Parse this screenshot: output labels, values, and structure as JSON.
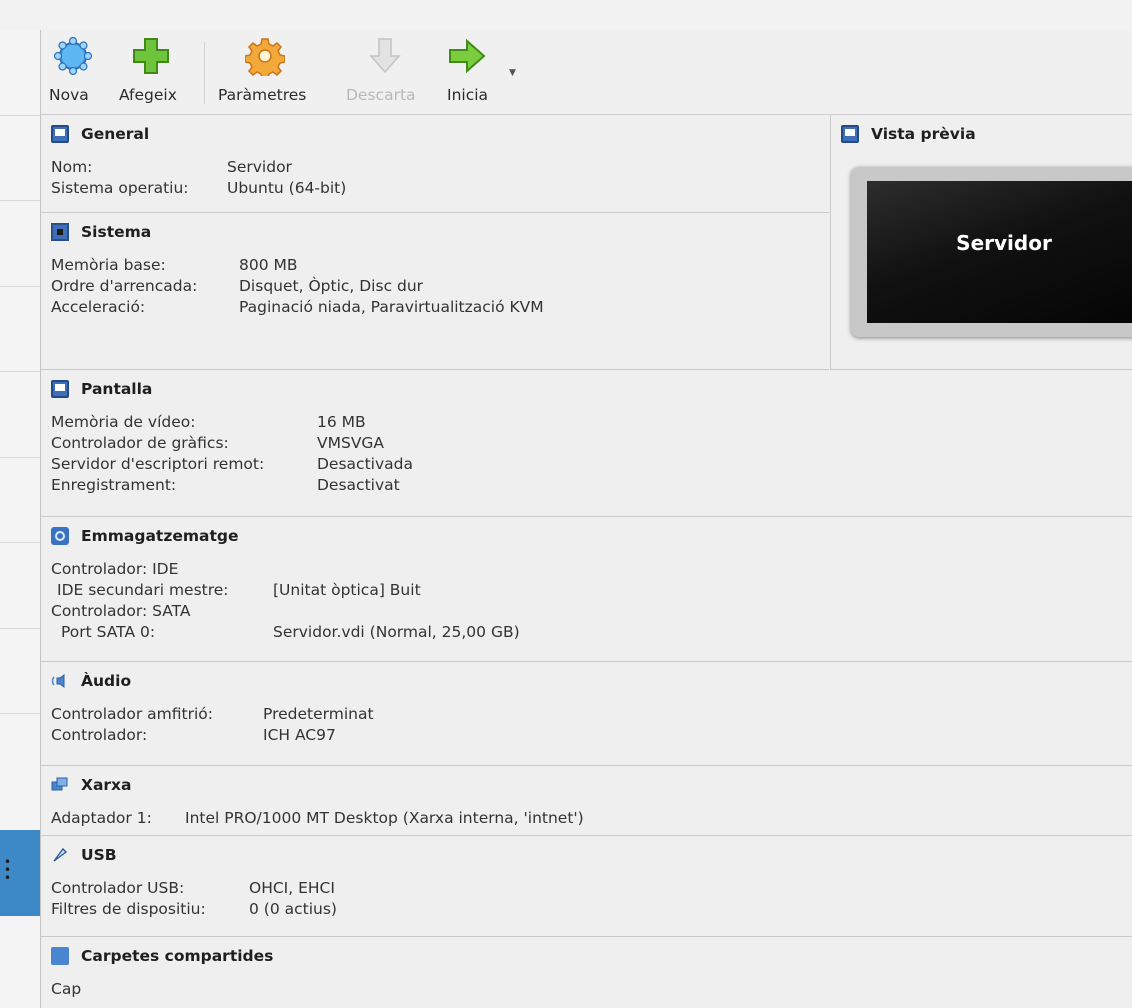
{
  "toolbar": {
    "new_label": "Nova",
    "add_label": "Afegeix",
    "settings_label": "Paràmetres",
    "discard_label": "Descarta",
    "start_label": "Inicia"
  },
  "sections": {
    "general": {
      "title": "General",
      "rows": [
        [
          "Nom:",
          "Servidor"
        ],
        [
          "Sistema operatiu:",
          "Ubuntu (64-bit)"
        ]
      ]
    },
    "system": {
      "title": "Sistema",
      "rows": [
        [
          "Memòria base:",
          "800 MB"
        ],
        [
          "Ordre d'arrencada:",
          "Disquet, Òptic, Disc dur"
        ],
        [
          "Acceleració:",
          "Paginació niada, Paravirtualització KVM"
        ]
      ]
    },
    "preview": {
      "title": "Vista prèvia",
      "vm_name": "Servidor"
    },
    "display": {
      "title": "Pantalla",
      "rows": [
        [
          "Memòria de vídeo:",
          "16 MB"
        ],
        [
          "Controlador de gràfics:",
          "VMSVGA"
        ],
        [
          "Servidor d'escriptori remot:",
          "Desactivada"
        ],
        [
          "Enregistrament:",
          "Desactivat"
        ]
      ]
    },
    "storage": {
      "title": "Emmagatzematge",
      "rows": [
        [
          "Controlador: IDE",
          ""
        ],
        [
          "IDE secundari mestre:",
          "[Unitat òptica] Buit"
        ],
        [
          "Controlador: SATA",
          ""
        ],
        [
          "Port SATA 0:",
          "Servidor.vdi (Normal, 25,00 GB)"
        ]
      ]
    },
    "audio": {
      "title": "Àudio",
      "rows": [
        [
          "Controlador amfitrió:",
          "Predeterminat"
        ],
        [
          "Controlador:",
          "ICH AC97"
        ]
      ]
    },
    "network": {
      "title": "Xarxa",
      "rows": [
        [
          "Adaptador 1:",
          "Intel PRO/1000 MT Desktop (Xarxa interna, 'intnet')"
        ]
      ]
    },
    "usb": {
      "title": "USB",
      "rows": [
        [
          "Controlador USB:",
          "OHCI, EHCI"
        ],
        [
          "Filtres de dispositiu:",
          "0 (0 actius)"
        ]
      ]
    },
    "shared": {
      "title": "Carpetes compartides",
      "rows": [
        [
          "Cap",
          ""
        ]
      ]
    }
  }
}
